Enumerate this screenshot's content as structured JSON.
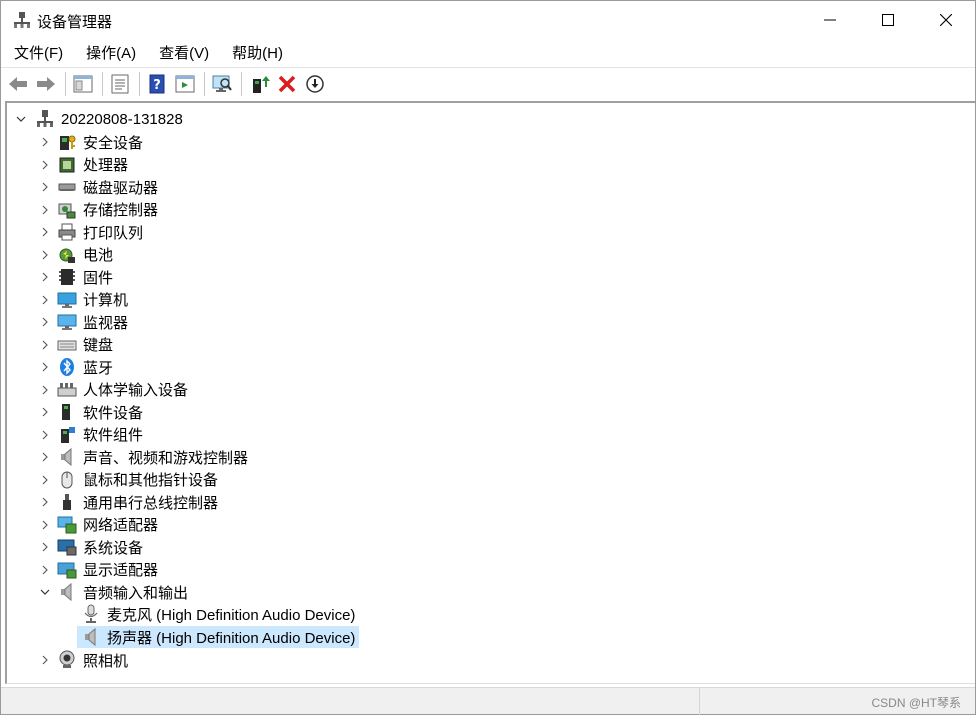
{
  "window": {
    "title": "设备管理器",
    "controls": {
      "minimize": "minimize",
      "maximize": "maximize",
      "close": "close"
    }
  },
  "menu": [
    "文件(F)",
    "操作(A)",
    "查看(V)",
    "帮助(H)"
  ],
  "toolbar": {
    "buttons": [
      "back-arrow",
      "forward-arrow",
      "show-hide-console-tree",
      "properties",
      "help",
      "action-pane",
      "scan-hardware-changes",
      "update-driver",
      "uninstall-device",
      "disable-device"
    ]
  },
  "tree": {
    "root": "20220808-131828",
    "categories": [
      {
        "label": "安全设备",
        "icon": "security-device-icon",
        "expanded": false
      },
      {
        "label": "处理器",
        "icon": "processor-icon",
        "expanded": false
      },
      {
        "label": "磁盘驱动器",
        "icon": "disk-drive-icon",
        "expanded": false
      },
      {
        "label": "存储控制器",
        "icon": "storage-controller-icon",
        "expanded": false
      },
      {
        "label": "打印队列",
        "icon": "printer-icon",
        "expanded": false
      },
      {
        "label": "电池",
        "icon": "battery-icon",
        "expanded": false
      },
      {
        "label": "固件",
        "icon": "firmware-icon",
        "expanded": false
      },
      {
        "label": "计算机",
        "icon": "computer-icon",
        "expanded": false
      },
      {
        "label": "监视器",
        "icon": "monitor-icon",
        "expanded": false
      },
      {
        "label": "键盘",
        "icon": "keyboard-icon",
        "expanded": false
      },
      {
        "label": "蓝牙",
        "icon": "bluetooth-icon",
        "expanded": false
      },
      {
        "label": "人体学输入设备",
        "icon": "hid-icon",
        "expanded": false
      },
      {
        "label": "软件设备",
        "icon": "software-device-icon",
        "expanded": false
      },
      {
        "label": "软件组件",
        "icon": "software-component-icon",
        "expanded": false
      },
      {
        "label": "声音、视频和游戏控制器",
        "icon": "sound-icon",
        "expanded": false
      },
      {
        "label": "鼠标和其他指针设备",
        "icon": "mouse-icon",
        "expanded": false
      },
      {
        "label": "通用串行总线控制器",
        "icon": "usb-icon",
        "expanded": false
      },
      {
        "label": "网络适配器",
        "icon": "network-adapter-icon",
        "expanded": false
      },
      {
        "label": "系统设备",
        "icon": "system-device-icon",
        "expanded": false
      },
      {
        "label": "显示适配器",
        "icon": "display-adapter-icon",
        "expanded": false
      },
      {
        "label": "音频输入和输出",
        "icon": "audio-io-icon",
        "expanded": true
      },
      {
        "label": "照相机",
        "icon": "camera-icon",
        "expanded": false
      }
    ],
    "audio_children": [
      {
        "label": "麦克风 (High Definition Audio Device)",
        "icon": "microphone-icon",
        "selected": false
      },
      {
        "label": "扬声器 (High Definition Audio Device)",
        "icon": "speaker-icon",
        "selected": true
      }
    ]
  },
  "status": {
    "watermark": "CSDN @HT琴系"
  },
  "colors": {
    "selection": "#cce8ff",
    "statusbar": "#f0f0f0",
    "accent_green": "#2e8b3a",
    "accent_red": "#d81e1e"
  }
}
